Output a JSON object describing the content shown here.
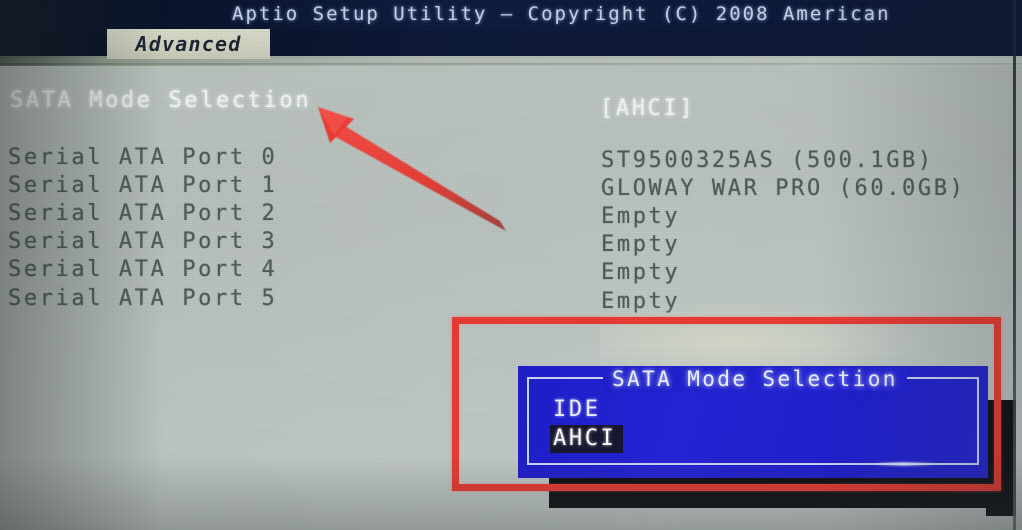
{
  "window": {
    "title": "Aptio Setup Utility – Copyright (C) 2008 American",
    "title_truncated": true
  },
  "tabs": [
    {
      "label": "Advanced",
      "active": true
    }
  ],
  "colors": {
    "titlebar_bg": "#0b1838",
    "screen_bg": "#b6bfbc",
    "tab_bg": "#d4d6c4",
    "dialog_bg": "#2020d4",
    "dialog_border": "#cdd6f6",
    "highlight_bg": "#14142e",
    "annotation_red": "#ea3a33",
    "text_bright": "#f2f5f6",
    "text_dim": "#4e5a5c"
  },
  "main": {
    "rows": [
      {
        "label": "SATA Mode Selection",
        "value": "[AHCI]",
        "style": "bright",
        "selected": true
      },
      {
        "label": "Serial ATA Port 0",
        "value": "ST9500325AS    (500.1GB)",
        "style": "dim",
        "selected": false
      },
      {
        "label": "Serial ATA Port 1",
        "value": "GLOWAY WAR PRO (60.0GB)",
        "style": "dim",
        "selected": false
      },
      {
        "label": "Serial ATA Port 2",
        "value": "Empty",
        "style": "dim",
        "selected": false
      },
      {
        "label": "Serial ATA Port 3",
        "value": "Empty",
        "style": "dim",
        "selected": false
      },
      {
        "label": "Serial ATA Port 4",
        "value": "Empty",
        "style": "dim",
        "selected": false
      },
      {
        "label": "Serial ATA Port 5",
        "value": "Empty",
        "style": "dim",
        "selected": false
      }
    ]
  },
  "dialog": {
    "title": "SATA Mode Selection",
    "options": [
      {
        "label": "IDE",
        "selected": false
      },
      {
        "label": "AHCI",
        "selected": true
      }
    ]
  },
  "annotations": {
    "arrow": {
      "name": "red-arrow",
      "points_to": "SATA Mode Selection"
    },
    "box": {
      "name": "red-rectangle",
      "surrounds": "SATA Mode Selection dialog"
    }
  }
}
